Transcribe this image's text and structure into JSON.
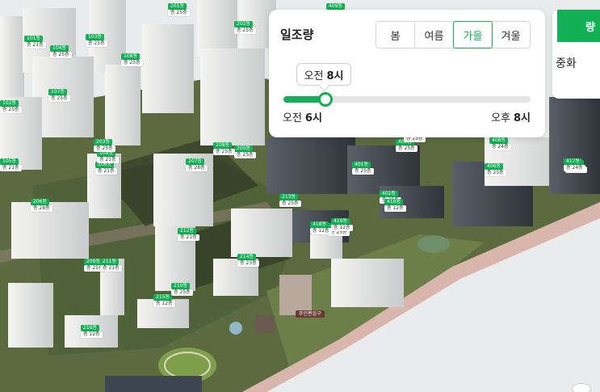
{
  "panel": {
    "title": "일조량",
    "seasons": [
      {
        "label": "봄",
        "active": false
      },
      {
        "label": "여름",
        "active": false
      },
      {
        "label": "가을",
        "active": true
      },
      {
        "label": "겨울",
        "active": false
      }
    ],
    "tooltip": {
      "prefix": "오전",
      "value": "8시"
    },
    "slider": {
      "min_prefix": "오전",
      "min_value": "6시",
      "max_prefix": "오후",
      "max_value": "8시",
      "position": 0.17
    }
  },
  "side_card": {
    "tab_label": "량",
    "text": "중화"
  },
  "map": {
    "entrance_label": "주민편입구",
    "markers": [
      {
        "num": "101동",
        "floor": "층 21층"
      },
      {
        "num": "102동",
        "floor": "층 25층"
      },
      {
        "num": "103동",
        "floor": "층 25층"
      },
      {
        "num": "105동",
        "floor": "층 21층"
      },
      {
        "num": "104동",
        "floor": "층 25층"
      },
      {
        "num": "106동",
        "floor": "층 21층"
      },
      {
        "num": "107동",
        "floor": "층 25층"
      },
      {
        "num": "108동",
        "floor": "층 25층"
      },
      {
        "num": "109동",
        "floor": "층 21층"
      },
      {
        "num": "201동",
        "floor": "층 25층"
      },
      {
        "num": "202동",
        "floor": "층 25층"
      },
      {
        "num": "203동",
        "floor": "층 25층"
      },
      {
        "num": "205동",
        "floor": "층 25층"
      },
      {
        "num": "206동",
        "floor": "층 28층"
      },
      {
        "num": "207동",
        "floor": "층 28층"
      },
      {
        "num": "208동",
        "floor": "층 25층"
      },
      {
        "num": "209동",
        "floor": "층 25층"
      },
      {
        "num": "210동",
        "floor": "층 25층"
      },
      {
        "num": "211동",
        "floor": "층 21층"
      },
      {
        "num": "212동",
        "floor": "층 21층"
      },
      {
        "num": "213동",
        "floor": "층 25층"
      },
      {
        "num": "214동",
        "floor": "층 23층"
      },
      {
        "num": "215동",
        "floor": "층 12층"
      },
      {
        "num": "216동",
        "floor": "층 12층"
      },
      {
        "num": "401동",
        "floor": "층 25층"
      },
      {
        "num": "402동",
        "floor": "층 25층"
      },
      {
        "num": "403동",
        "floor": "층 25층"
      },
      {
        "num": "405동",
        "floor": "층 25층"
      },
      {
        "num": "406동",
        "floor": "층 25층"
      },
      {
        "num": "407동",
        "floor": "층 25층"
      },
      {
        "num": "408동",
        "floor": "층 24층"
      },
      {
        "num": "409동",
        "floor": "층 25층"
      },
      {
        "num": "410동",
        "floor": "층 25층"
      },
      {
        "num": "416동",
        "floor": "층 12층"
      },
      {
        "num": "417동",
        "floor": "층 24층"
      },
      {
        "num": "418동",
        "floor": "층 12층"
      },
      {
        "num": "419동",
        "floor": "층 12층"
      }
    ]
  }
}
